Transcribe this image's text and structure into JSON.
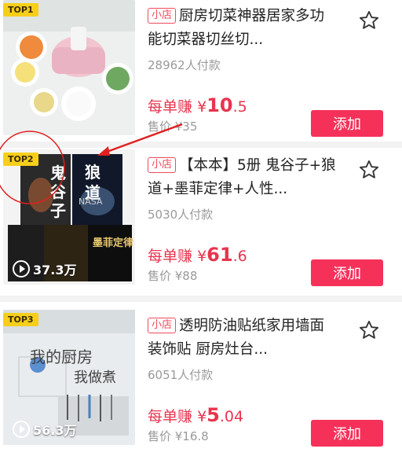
{
  "items": [
    {
      "rank": "TOP1",
      "shop_badge": "小店",
      "title": "厨房切菜神器居家多功能切菜器切丝切...",
      "sales": "28962人付款",
      "earn_label": "每单赚",
      "earn_currency": "¥",
      "earn_int": "10",
      "earn_dec": ".5",
      "price": "售价 ¥35",
      "add_label": "添加",
      "views": ""
    },
    {
      "rank": "TOP2",
      "shop_badge": "小店",
      "title": "【本本】5册 鬼谷子+狼道+墨菲定律+人性...",
      "sales": "5030人付款",
      "earn_label": "每单赚",
      "earn_currency": "¥",
      "earn_int": "61",
      "earn_dec": ".6",
      "price": "售价 ¥88",
      "add_label": "添加",
      "views": "37.3万",
      "book_titles": [
        "鬼谷子",
        "狼道",
        "墨菲定律"
      ]
    },
    {
      "rank": "TOP3",
      "shop_badge": "小店",
      "title": "透明防油贴纸家用墙面装饰贴 厨房灶台...",
      "sales": "6051人付款",
      "earn_label": "每单赚",
      "earn_currency": "¥",
      "earn_int": "5",
      "earn_dec": ".04",
      "price": "售价 ¥16.8",
      "add_label": "添加",
      "views": "56.3万",
      "wall_text": [
        "我的厨房",
        "我做煮"
      ]
    }
  ],
  "colors": {
    "accent": "#f5315a",
    "price_red": "#e8344e",
    "rank_yellow": "#f6cf1b",
    "annotation_red": "#e02020"
  }
}
